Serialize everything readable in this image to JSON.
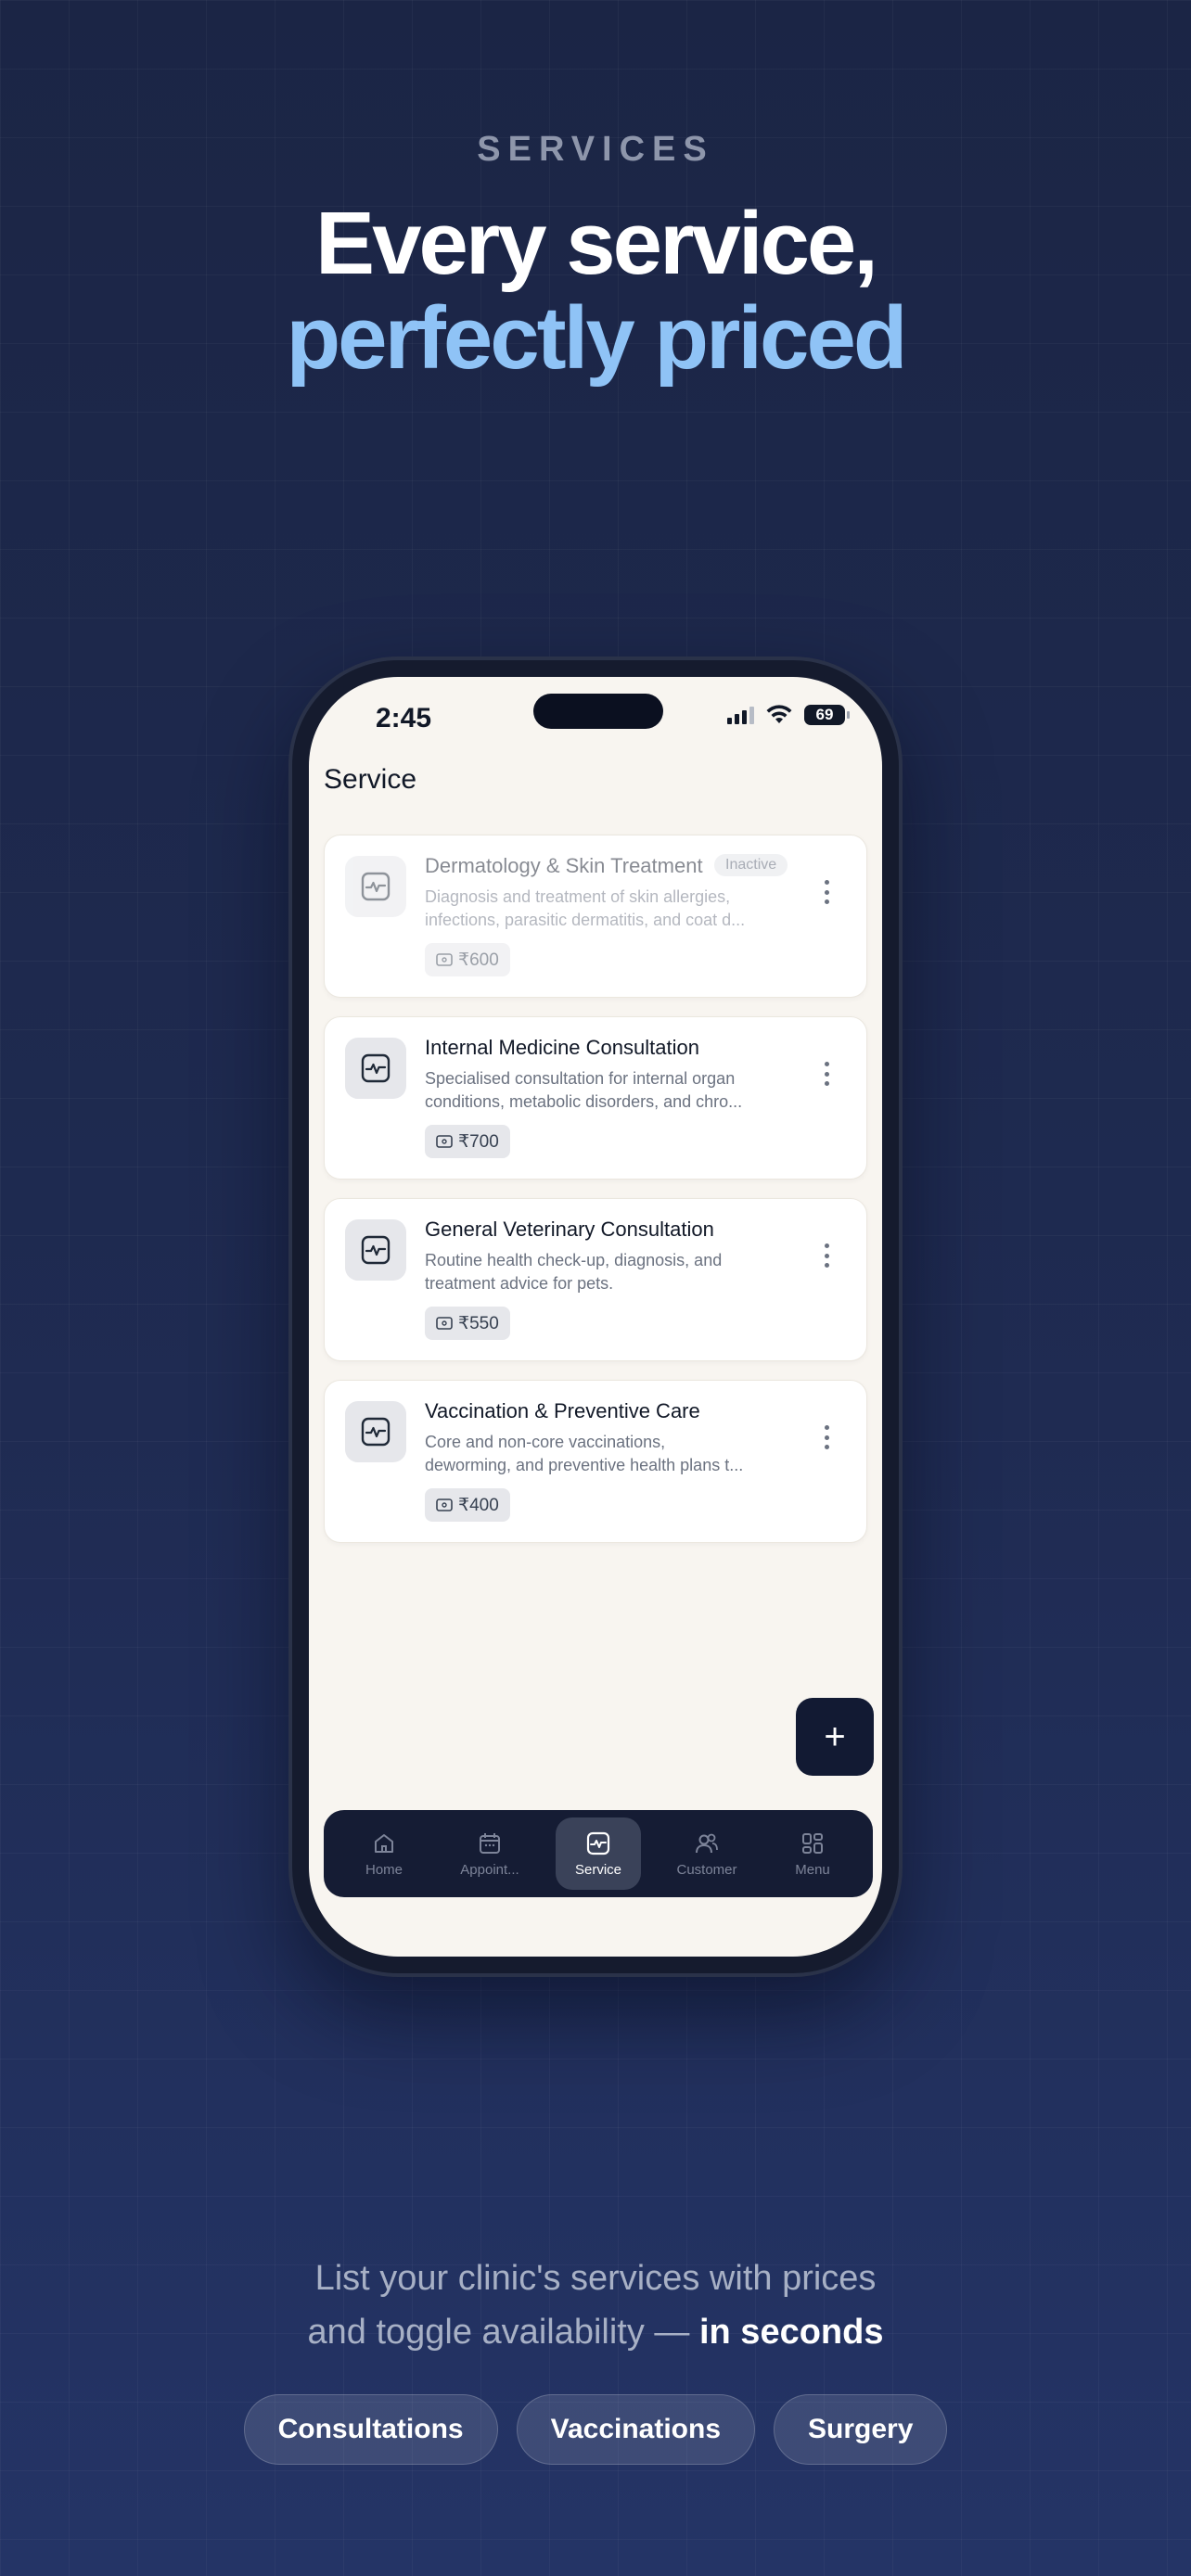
{
  "hero": {
    "eyebrow": "SERVICES",
    "headline_line1": "Every service,",
    "headline_line2": "perfectly priced"
  },
  "status_bar": {
    "time": "2:45",
    "battery": "69"
  },
  "app": {
    "page_title": "Service",
    "services": [
      {
        "name": "Dermatology & Skin Treatment",
        "badge": "Inactive",
        "desc_line1": "Diagnosis and treatment of skin allergies,",
        "desc_line2": "infections, parasitic dermatitis, and coat d...",
        "price": "₹600",
        "active": false
      },
      {
        "name": "Internal Medicine Consultation",
        "desc_line1": "Specialised consultation for internal organ",
        "desc_line2": "conditions, metabolic disorders, and chro...",
        "price": "₹700",
        "active": true
      },
      {
        "name": "General Veterinary Consultation",
        "desc_line1": "Routine health check-up, diagnosis, and",
        "desc_line2": "treatment advice for pets.",
        "price": "₹550",
        "active": true
      },
      {
        "name": "Vaccination & Preventive Care",
        "desc_line1": "Core and non-core vaccinations,",
        "desc_line2": "deworming, and preventive health plans t...",
        "price": "₹400",
        "active": true
      }
    ],
    "fab_label": "+",
    "tabs": [
      {
        "label": "Home",
        "icon": "home-icon"
      },
      {
        "label": "Appoint...",
        "icon": "calendar-icon"
      },
      {
        "label": "Service",
        "icon": "heartbeat-icon"
      },
      {
        "label": "Customer",
        "icon": "users-icon"
      },
      {
        "label": "Menu",
        "icon": "grid-icon"
      }
    ],
    "active_tab": "Service"
  },
  "footer": {
    "subtitle_line1": "List your clinic's services with prices",
    "subtitle_line2": "and toggle availability — ",
    "subtitle_emphasis": "in seconds",
    "chips": [
      "Consultations",
      "Vaccinations",
      "Surgery"
    ]
  },
  "colors": {
    "background": "#1f2b52",
    "accent_blue": "#8fc3f6",
    "tabbar": "#151c34",
    "screen": "#f8f5f0"
  }
}
